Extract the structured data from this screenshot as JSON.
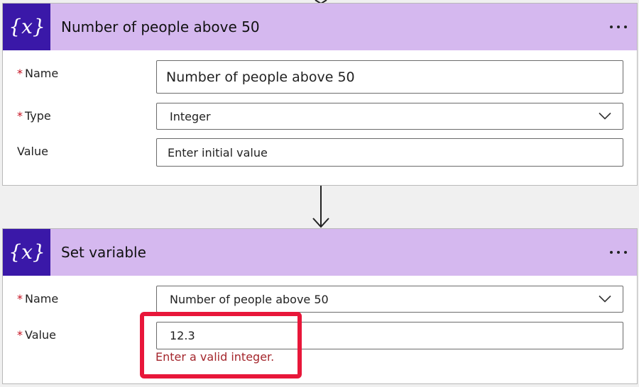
{
  "card1": {
    "title": "Number of people above 50",
    "required_mark": "*",
    "name_label": "Name",
    "name_value": "Number of people above 50",
    "type_label": "Type",
    "type_value": "Integer",
    "value_label": "Value",
    "value_placeholder": "Enter initial value"
  },
  "card2": {
    "title": "Set variable",
    "required_mark": "*",
    "name_label": "Name",
    "name_value": "Number of people above 50",
    "value_label": "Value",
    "value_value": "12.3",
    "error": "Enter a valid integer."
  },
  "colors": {
    "header_bg": "#d5b8ef",
    "icon_bg": "#3a18a8",
    "error_text": "#a4262c",
    "highlight": "#e8173a",
    "required": "#c50f1f"
  },
  "icons": {
    "header_icon": "variable-icon",
    "menu_icon": "more-icon",
    "dropdown_icon": "chevron-down-icon",
    "connector": "arrow-down-icon"
  }
}
